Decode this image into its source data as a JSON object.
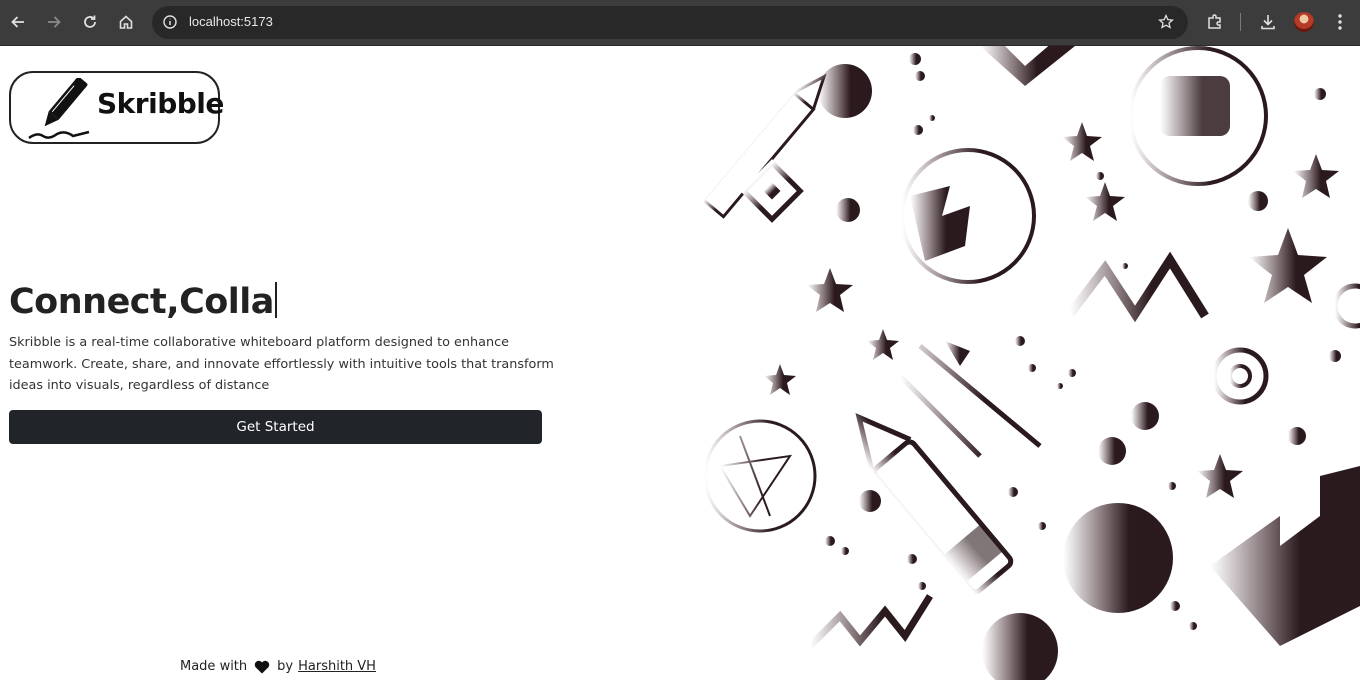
{
  "browser": {
    "url": "localhost:5173",
    "icons": [
      "back-icon",
      "forward-icon",
      "reload-icon",
      "home-icon",
      "site-info-icon",
      "bookmark-star-icon",
      "extensions-icon",
      "download-icon",
      "profile-avatar",
      "menu-icon"
    ]
  },
  "logo": {
    "text": "Skribble",
    "icon": "pencil-icon"
  },
  "hero": {
    "headline": "Connect,Colla",
    "description": "Skribble is a real-time collaborative whiteboard platform designed to enhance teamwork. Create, share, and innovate effortlessly with intuitive tools that transform ideas into visuals, regardless of distance",
    "cta_label": "Get Started"
  },
  "footer": {
    "prefix": "Made with",
    "by": "by",
    "author": "Harshith VH",
    "icon": "heart-icon"
  },
  "colors": {
    "chrome": "#3c3c3c",
    "omnibox": "#282828",
    "button": "#212529",
    "art_ink": "#2b1a1d"
  }
}
